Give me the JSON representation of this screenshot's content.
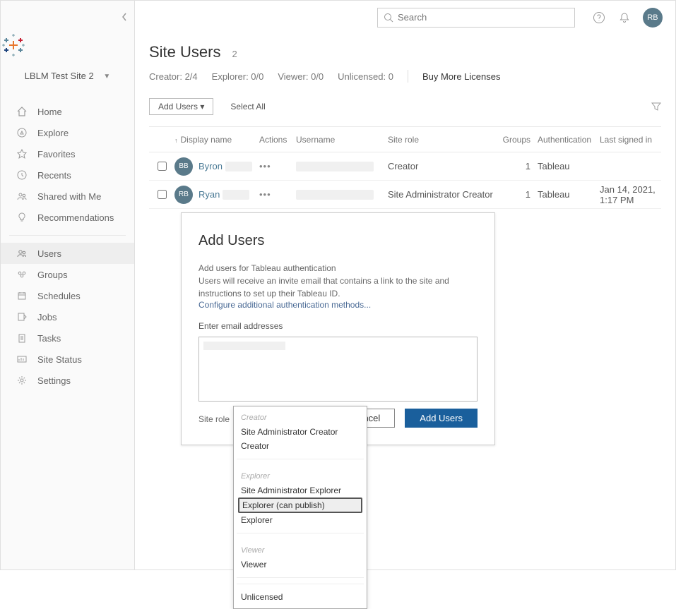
{
  "topbar": {
    "search_placeholder": "Search",
    "avatar_initials": "RB"
  },
  "sidebar": {
    "site_name": "LBLM Test Site 2",
    "items_top": [
      {
        "label": "Home"
      },
      {
        "label": "Explore"
      },
      {
        "label": "Favorites"
      },
      {
        "label": "Recents"
      },
      {
        "label": "Shared with Me"
      },
      {
        "label": "Recommendations"
      }
    ],
    "items_bottom": [
      {
        "label": "Users"
      },
      {
        "label": "Groups"
      },
      {
        "label": "Schedules"
      },
      {
        "label": "Jobs"
      },
      {
        "label": "Tasks"
      },
      {
        "label": "Site Status"
      },
      {
        "label": "Settings"
      }
    ]
  },
  "page": {
    "title": "Site Users",
    "count": "2",
    "stats": {
      "creator": "Creator: 2/4",
      "explorer": "Explorer: 0/0",
      "viewer": "Viewer: 0/0",
      "unlicensed": "Unlicensed: 0"
    },
    "buy_more": "Buy More Licenses",
    "add_users_btn": "Add Users ▾",
    "select_all": "Select All"
  },
  "table": {
    "headers": {
      "display_name": "Display name",
      "actions": "Actions",
      "username": "Username",
      "site_role": "Site role",
      "groups": "Groups",
      "authentication": "Authentication",
      "last_signed_in": "Last signed in"
    },
    "rows": [
      {
        "initials": "BB",
        "name": "Byron",
        "role": "Creator",
        "groups": "1",
        "auth": "Tableau",
        "signed": ""
      },
      {
        "initials": "RB",
        "name": "Ryan",
        "role": "Site Administrator Creator",
        "groups": "1",
        "auth": "Tableau",
        "signed": "Jan 14, 2021, 1:17 PM"
      }
    ]
  },
  "dialog": {
    "title": "Add Users",
    "line1": "Add users for Tableau authentication",
    "line2": "Users will receive an invite email that contains a link to the site and instructions to set up their Tableau ID.",
    "config_link": "Configure additional authentication methods...",
    "enter_label": "Enter email addresses",
    "site_role_label": "Site role",
    "role_selected": "Explorer (can publish)",
    "cancel": "Cancel",
    "submit": "Add Users"
  },
  "dropdown": {
    "groups": [
      {
        "label": "Creator",
        "items": [
          "Site Administrator Creator",
          "Creator"
        ]
      },
      {
        "label": "Explorer",
        "items": [
          "Site Administrator Explorer",
          "Explorer (can publish)",
          "Explorer"
        ]
      },
      {
        "label": "Viewer",
        "items": [
          "Viewer"
        ]
      },
      {
        "label": null,
        "items": [
          "Unlicensed"
        ]
      }
    ],
    "highlighted": "Explorer (can publish)"
  }
}
